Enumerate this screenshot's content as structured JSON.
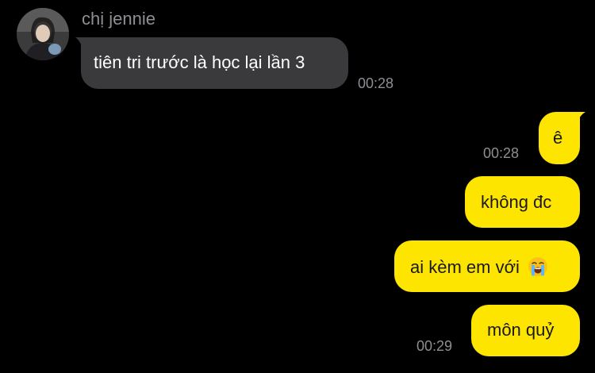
{
  "chat": {
    "sender_name": "chị jennie",
    "messages": [
      {
        "from": "other",
        "text": "tiên tri trước là học lại lần 3",
        "time": "00:28"
      },
      {
        "from": "me",
        "text": "ê",
        "time": "00:28"
      },
      {
        "from": "me",
        "text": "không đc"
      },
      {
        "from": "me",
        "text": "ai kèm em với",
        "emoji": "😭"
      },
      {
        "from": "me",
        "text": "môn quỷ",
        "time": "00:29"
      }
    ]
  },
  "colors": {
    "background": "#000000",
    "incoming_bubble": "#3a3a3c",
    "outgoing_bubble": "#fee500",
    "timestamp": "#8e8e93"
  },
  "icons": {
    "avatar": "profile-photo",
    "emoji": "loudly-crying-face"
  }
}
